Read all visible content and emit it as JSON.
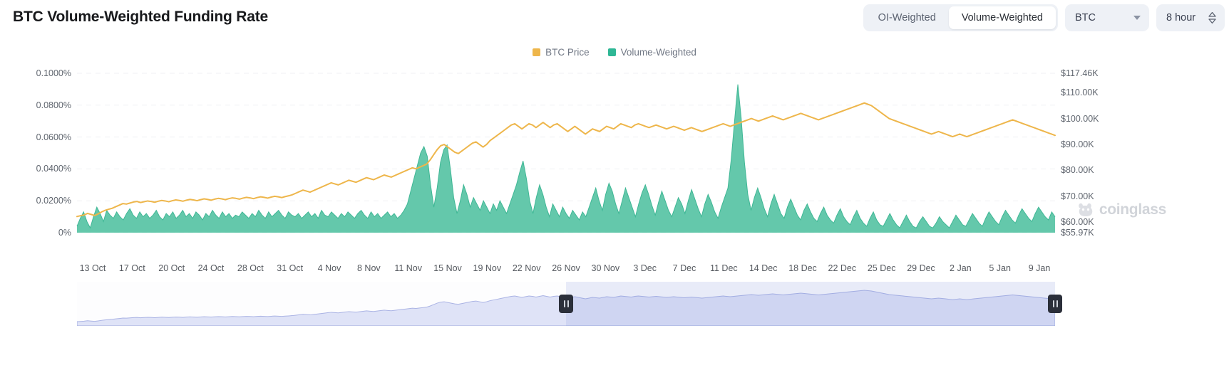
{
  "header": {
    "title": "BTC Volume-Weighted Funding Rate",
    "toggle": {
      "oi_weighted": "OI-Weighted",
      "volume_weighted": "Volume-Weighted",
      "active": "Volume-Weighted"
    },
    "asset_select": {
      "value": "BTC",
      "icon": "chevron-down-icon"
    },
    "interval_select": {
      "value": "8 hour",
      "icon": "stepper-updown-icon"
    }
  },
  "legend": [
    {
      "label": "BTC Price",
      "color": "#eeb64b"
    },
    {
      "label": "Volume-Weighted",
      "color": "#2eb795"
    }
  ],
  "watermark": {
    "text": "coinglass"
  },
  "colors": {
    "price_line": "#eeb64b",
    "funding_area": "#57c3a4",
    "funding_area_fill": "#5cc5a7",
    "grid": "#f0f1f3",
    "range_area": "#c7cdf0",
    "range_selection": "#7a8cdc",
    "handle": "#2b2f3a"
  },
  "chart_data": {
    "type": "area",
    "title": "BTC Volume-Weighted Funding Rate",
    "xlabel": "",
    "ylabel": "Funding Rate",
    "y2label": "BTC Price",
    "grid": true,
    "legend_position": "top-center",
    "y_left_ticks": [
      "0%",
      "0.0200%",
      "0.0400%",
      "0.0600%",
      "0.0800%",
      "0.1000%"
    ],
    "y_left_values": [
      0,
      0.02,
      0.04,
      0.06,
      0.08,
      0.1
    ],
    "ylim": [
      0,
      0.1
    ],
    "y_right_ticks": [
      "$55.97K",
      "$60.00K",
      "$70.00K",
      "$80.00K",
      "$90.00K",
      "$100.00K",
      "$110.00K",
      "$117.46K"
    ],
    "y_right_values": [
      55.97,
      60.0,
      70.0,
      80.0,
      90.0,
      100.0,
      110.0,
      117.46
    ],
    "y2lim": [
      55.97,
      117.46
    ],
    "x_tick_labels": [
      "13 Oct",
      "17 Oct",
      "20 Oct",
      "24 Oct",
      "28 Oct",
      "31 Oct",
      "4 Nov",
      "8 Nov",
      "11 Nov",
      "15 Nov",
      "19 Nov",
      "22 Nov",
      "26 Nov",
      "30 Nov",
      "3 Dec",
      "7 Dec",
      "11 Dec",
      "14 Dec",
      "18 Dec",
      "22 Dec",
      "25 Dec",
      "29 Dec",
      "2 Jan",
      "5 Jan",
      "9 Jan"
    ],
    "series": [
      {
        "name": "Volume-Weighted",
        "type": "area",
        "axis": "left",
        "unit": "%",
        "color": "#57c3a4",
        "values": [
          0.004,
          0.009,
          0.013,
          0.007,
          0.003,
          0.01,
          0.016,
          0.012,
          0.007,
          0.014,
          0.011,
          0.009,
          0.013,
          0.01,
          0.008,
          0.012,
          0.015,
          0.011,
          0.009,
          0.013,
          0.01,
          0.012,
          0.009,
          0.011,
          0.014,
          0.01,
          0.008,
          0.012,
          0.01,
          0.013,
          0.009,
          0.011,
          0.014,
          0.01,
          0.012,
          0.009,
          0.013,
          0.011,
          0.008,
          0.012,
          0.01,
          0.014,
          0.011,
          0.009,
          0.013,
          0.01,
          0.012,
          0.009,
          0.011,
          0.01,
          0.013,
          0.011,
          0.009,
          0.012,
          0.01,
          0.014,
          0.011,
          0.009,
          0.013,
          0.01,
          0.012,
          0.014,
          0.011,
          0.009,
          0.013,
          0.011,
          0.01,
          0.012,
          0.009,
          0.011,
          0.013,
          0.01,
          0.012,
          0.009,
          0.014,
          0.011,
          0.01,
          0.013,
          0.011,
          0.009,
          0.012,
          0.01,
          0.013,
          0.011,
          0.009,
          0.012,
          0.014,
          0.011,
          0.009,
          0.013,
          0.01,
          0.012,
          0.009,
          0.011,
          0.013,
          0.01,
          0.012,
          0.009,
          0.011,
          0.014,
          0.018,
          0.026,
          0.034,
          0.042,
          0.05,
          0.054,
          0.048,
          0.03,
          0.016,
          0.028,
          0.044,
          0.052,
          0.055,
          0.04,
          0.022,
          0.012,
          0.02,
          0.03,
          0.024,
          0.016,
          0.022,
          0.018,
          0.014,
          0.02,
          0.016,
          0.012,
          0.018,
          0.014,
          0.02,
          0.016,
          0.012,
          0.018,
          0.024,
          0.03,
          0.038,
          0.045,
          0.034,
          0.02,
          0.012,
          0.022,
          0.03,
          0.024,
          0.016,
          0.01,
          0.018,
          0.014,
          0.01,
          0.016,
          0.012,
          0.009,
          0.014,
          0.011,
          0.008,
          0.013,
          0.01,
          0.016,
          0.022,
          0.028,
          0.02,
          0.014,
          0.024,
          0.031,
          0.026,
          0.018,
          0.012,
          0.02,
          0.028,
          0.022,
          0.016,
          0.01,
          0.018,
          0.025,
          0.03,
          0.024,
          0.017,
          0.011,
          0.019,
          0.026,
          0.02,
          0.014,
          0.01,
          0.016,
          0.022,
          0.018,
          0.012,
          0.02,
          0.027,
          0.021,
          0.015,
          0.01,
          0.018,
          0.024,
          0.019,
          0.013,
          0.009,
          0.016,
          0.022,
          0.028,
          0.046,
          0.07,
          0.093,
          0.072,
          0.044,
          0.024,
          0.014,
          0.022,
          0.028,
          0.022,
          0.015,
          0.01,
          0.018,
          0.024,
          0.018,
          0.012,
          0.009,
          0.016,
          0.021,
          0.016,
          0.011,
          0.008,
          0.014,
          0.018,
          0.013,
          0.009,
          0.007,
          0.012,
          0.016,
          0.011,
          0.008,
          0.006,
          0.011,
          0.015,
          0.01,
          0.007,
          0.005,
          0.01,
          0.014,
          0.009,
          0.006,
          0.004,
          0.009,
          0.013,
          0.008,
          0.005,
          0.004,
          0.008,
          0.012,
          0.008,
          0.005,
          0.003,
          0.007,
          0.011,
          0.007,
          0.004,
          0.003,
          0.007,
          0.01,
          0.007,
          0.004,
          0.003,
          0.006,
          0.01,
          0.007,
          0.005,
          0.003,
          0.007,
          0.011,
          0.008,
          0.005,
          0.004,
          0.008,
          0.012,
          0.009,
          0.006,
          0.004,
          0.009,
          0.013,
          0.01,
          0.007,
          0.005,
          0.01,
          0.014,
          0.011,
          0.008,
          0.006,
          0.011,
          0.015,
          0.012,
          0.009,
          0.007,
          0.012,
          0.016,
          0.013,
          0.01,
          0.008,
          0.013,
          0.01
        ]
      },
      {
        "name": "BTC Price",
        "type": "line",
        "axis": "right",
        "unit": "K USD",
        "color": "#eeb64b",
        "values": [
          62.2,
          62.5,
          62.8,
          63.4,
          63.0,
          62.6,
          63.2,
          64.0,
          64.6,
          65.0,
          65.4,
          66.0,
          66.6,
          67.2,
          67.0,
          67.4,
          67.8,
          68.0,
          67.6,
          67.9,
          68.2,
          68.0,
          67.7,
          68.1,
          68.4,
          68.2,
          67.9,
          68.3,
          68.6,
          68.4,
          68.1,
          68.5,
          68.8,
          68.6,
          68.3,
          68.7,
          69.0,
          68.8,
          68.5,
          68.9,
          69.2,
          69.0,
          68.7,
          69.1,
          69.4,
          69.2,
          68.9,
          69.3,
          69.6,
          69.4,
          69.1,
          69.5,
          69.8,
          69.6,
          69.3,
          69.7,
          70.0,
          69.8,
          69.5,
          69.9,
          70.2,
          70.6,
          71.2,
          71.8,
          72.4,
          72.0,
          71.6,
          72.2,
          72.8,
          73.4,
          74.0,
          74.6,
          75.2,
          74.8,
          74.4,
          75.0,
          75.6,
          76.2,
          75.8,
          75.4,
          76.0,
          76.6,
          77.2,
          76.8,
          76.4,
          77.0,
          77.6,
          78.2,
          77.8,
          77.4,
          78.0,
          78.6,
          79.2,
          79.8,
          80.4,
          81.0,
          80.6,
          81.2,
          81.8,
          82.4,
          84.0,
          86.0,
          88.0,
          89.5,
          90.0,
          89.0,
          88.0,
          87.0,
          86.5,
          87.5,
          88.5,
          89.5,
          90.5,
          91.0,
          90.0,
          89.0,
          90.0,
          91.5,
          92.5,
          93.5,
          94.5,
          95.5,
          96.5,
          97.5,
          98.0,
          97.0,
          96.0,
          97.0,
          98.0,
          97.5,
          96.5,
          97.5,
          98.5,
          97.5,
          96.5,
          97.5,
          98.0,
          97.0,
          96.0,
          95.0,
          96.0,
          97.0,
          96.0,
          95.0,
          94.0,
          95.0,
          96.0,
          95.5,
          95.0,
          96.0,
          97.0,
          96.5,
          96.0,
          97.0,
          98.0,
          97.5,
          97.0,
          96.5,
          97.5,
          98.0,
          97.5,
          97.0,
          96.5,
          97.0,
          97.5,
          97.0,
          96.5,
          96.0,
          96.5,
          97.0,
          96.5,
          96.0,
          95.5,
          96.0,
          96.5,
          96.0,
          95.5,
          95.0,
          95.5,
          96.0,
          96.5,
          97.0,
          97.5,
          98.0,
          97.5,
          97.0,
          97.5,
          98.0,
          98.5,
          99.0,
          99.5,
          100.0,
          99.5,
          99.0,
          99.5,
          100.0,
          100.5,
          101.0,
          100.5,
          100.0,
          99.5,
          100.0,
          100.5,
          101.0,
          101.5,
          102.0,
          101.5,
          101.0,
          100.5,
          100.0,
          99.5,
          100.0,
          100.5,
          101.0,
          101.5,
          102.0,
          102.5,
          103.0,
          103.5,
          104.0,
          104.5,
          105.0,
          105.5,
          106.0,
          105.5,
          105.0,
          104.0,
          103.0,
          102.0,
          101.0,
          100.0,
          99.5,
          99.0,
          98.5,
          98.0,
          97.5,
          97.0,
          96.5,
          96.0,
          95.5,
          95.0,
          94.5,
          94.0,
          94.5,
          95.0,
          94.5,
          94.0,
          93.5,
          93.0,
          93.5,
          94.0,
          93.5,
          93.0,
          93.5,
          94.0,
          94.5,
          95.0,
          95.5,
          96.0,
          96.5,
          97.0,
          97.5,
          98.0,
          98.5,
          99.0,
          99.5,
          99.0,
          98.5,
          98.0,
          97.5,
          97.0,
          96.5,
          96.0,
          95.5,
          95.0,
          94.5,
          94.0,
          93.5
        ]
      }
    ]
  },
  "range_slider": {
    "left_handle": "range-handle-left",
    "right_handle": "range-handle-right"
  }
}
